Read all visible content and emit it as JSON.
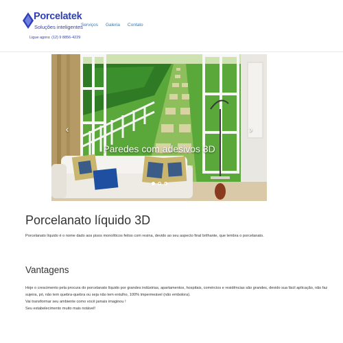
{
  "header": {
    "logo": {
      "name": "Porcelatek",
      "tagline": "Soluções inteligentes",
      "phone": "Ligue agora: (12) 9 8856-4229"
    },
    "nav": [
      "Serviços",
      "Galeria",
      "Contato"
    ]
  },
  "carousel": {
    "caption": "Paredes com adesivos 3D",
    "prev_icon": "chevron-left-icon",
    "next_icon": "chevron-right-icon",
    "prev_glyph": "‹",
    "next_glyph": "›",
    "slide_count": 3,
    "active_slide": 1
  },
  "intro": {
    "title": "Porcelanato líquido 3D",
    "text": "Porcelanato líquido é o nome dado aos pisos monolíticos feitos com resina, devido ao seu aspecto final brilhante, que lembra o porcelanato."
  },
  "advantages": {
    "title": "Vantagens",
    "lines": [
      "Hoje o crescimento pela procura do porcelanato líquido por grandes indústrias, apartamentos, hospitais, comércios e residências são grandes, devido sua fácil aplicação, não faz",
      "sujeira, pó, não tem quebra-quebra ou seja não tem entulho, 100% impermeável (não embolora).",
      "Vai transformar seu ambiente como você jamais imaginou !",
      "Seu estabelecimento muito mais notável!"
    ]
  },
  "colors": {
    "brand": "#2f3fb8",
    "link": "#337ab7"
  }
}
